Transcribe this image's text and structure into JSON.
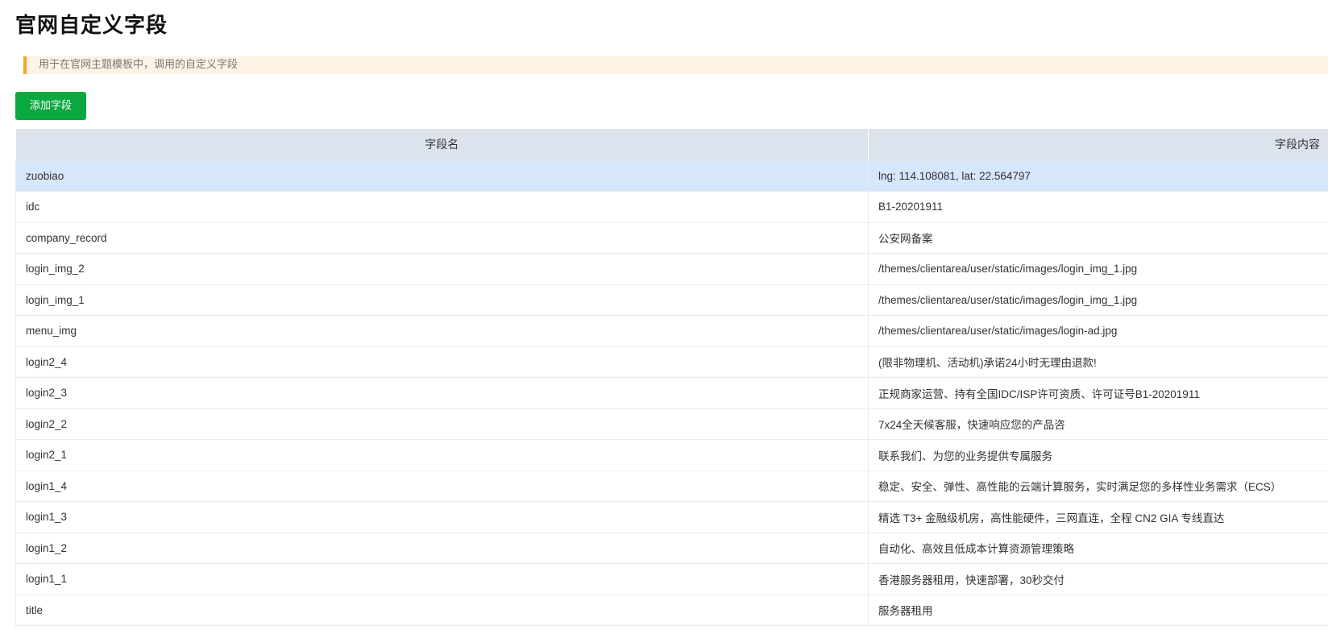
{
  "page": {
    "title": "官网自定义字段",
    "notice": "用于在官网主题模板中，调用的自定义字段",
    "add_button": "添加字段"
  },
  "table": {
    "headers": [
      "字段名",
      "字段内容"
    ],
    "rows": [
      {
        "name": "zuobiao",
        "content": "lng: 114.108081, lat: 22.564797",
        "selected": true
      },
      {
        "name": "idc",
        "content": "B1-20201911"
      },
      {
        "name": "company_record",
        "content": "公安网备案"
      },
      {
        "name": "login_img_2",
        "content": "/themes/clientarea/user/static/images/login_img_1.jpg"
      },
      {
        "name": "login_img_1",
        "content": "/themes/clientarea/user/static/images/login_img_1.jpg"
      },
      {
        "name": "menu_img",
        "content": "/themes/clientarea/user/static/images/login-ad.jpg"
      },
      {
        "name": "login2_4",
        "content": "(限非物理机、活动机)承诺24小时无理由退款!"
      },
      {
        "name": "login2_3",
        "content": "正规商家运营、持有全国IDC/ISP许可资质、许可证号B1-20201911"
      },
      {
        "name": "login2_2",
        "content": "7x24全天候客服，快速响应您的产品咨"
      },
      {
        "name": "login2_1",
        "content": "联系我们、为您的业务提供专属服务"
      },
      {
        "name": "login1_4",
        "content": "稳定、安全、弹性、高性能的云端计算服务，实时满足您的多样性业务需求（ECS）"
      },
      {
        "name": "login1_3",
        "content": "精选 T3+ 金融级机房，高性能硬件，三网直连，全程 CN2 GIA 专线直达"
      },
      {
        "name": "login1_2",
        "content": "自动化、高效且低成本计算资源管理策略"
      },
      {
        "name": "login1_1",
        "content": "香港服务器租用，快速部署，30秒交付"
      },
      {
        "name": "title",
        "content": "服务器租用"
      }
    ]
  },
  "colors": {
    "button_green": "#0aa83f",
    "notice_bar": "#f5a623",
    "notice_bg": "#fdf3e4",
    "header_bg": "#dde3ed",
    "selected_row_bg": "#d6e6fb"
  }
}
